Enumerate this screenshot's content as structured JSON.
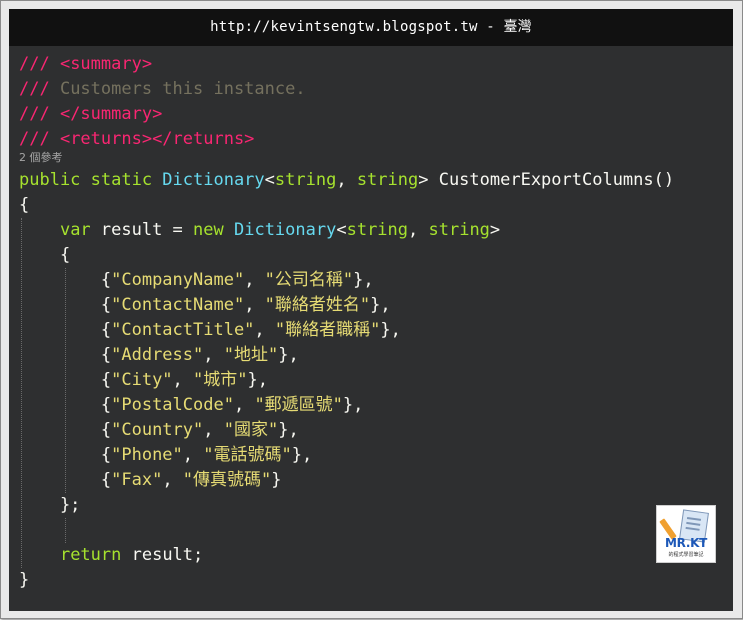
{
  "banner": {
    "text": "http://kevintsengtw.blogspot.tw - 臺灣"
  },
  "codelens": {
    "text": "2 個參考"
  },
  "colors": {
    "background": "#2e2f30",
    "default": "#f8f8f2",
    "comment_marker": "#f92672",
    "comment_text": "#75715e",
    "keyword": "#a6e22e",
    "type": "#66d9ef",
    "string": "#e6db74"
  },
  "code": {
    "lines": [
      [
        {
          "t": "/// ",
          "c": "comment_marker"
        },
        {
          "t": "<summary>",
          "c": "comment_marker"
        }
      ],
      [
        {
          "t": "/// ",
          "c": "comment_marker"
        },
        {
          "t": "Customers this instance.",
          "c": "comment_text"
        }
      ],
      [
        {
          "t": "/// ",
          "c": "comment_marker"
        },
        {
          "t": "</summary>",
          "c": "comment_marker"
        }
      ],
      [
        {
          "t": "/// ",
          "c": "comment_marker"
        },
        {
          "t": "<returns></returns>",
          "c": "comment_marker"
        }
      ],
      [
        {
          "t": "public static ",
          "c": "keyword"
        },
        {
          "t": "Dictionary",
          "c": "type"
        },
        {
          "t": "<",
          "c": "default"
        },
        {
          "t": "string",
          "c": "keyword"
        },
        {
          "t": ", ",
          "c": "default"
        },
        {
          "t": "string",
          "c": "keyword"
        },
        {
          "t": "> CustomerExportColumns()",
          "c": "default"
        }
      ],
      [
        {
          "t": "{",
          "c": "default"
        }
      ],
      [
        {
          "t": "    ",
          "c": "default"
        },
        {
          "t": "var",
          "c": "keyword"
        },
        {
          "t": " result = ",
          "c": "default"
        },
        {
          "t": "new ",
          "c": "keyword"
        },
        {
          "t": "Dictionary",
          "c": "type"
        },
        {
          "t": "<",
          "c": "default"
        },
        {
          "t": "string",
          "c": "keyword"
        },
        {
          "t": ", ",
          "c": "default"
        },
        {
          "t": "string",
          "c": "keyword"
        },
        {
          "t": ">",
          "c": "default"
        }
      ],
      [
        {
          "t": "    {",
          "c": "default"
        }
      ],
      [
        {
          "t": "        {",
          "c": "default"
        },
        {
          "t": "\"CompanyName\"",
          "c": "string"
        },
        {
          "t": ", ",
          "c": "default"
        },
        {
          "t": "\"公司名稱\"",
          "c": "string"
        },
        {
          "t": "},",
          "c": "default"
        }
      ],
      [
        {
          "t": "        {",
          "c": "default"
        },
        {
          "t": "\"ContactName\"",
          "c": "string"
        },
        {
          "t": ", ",
          "c": "default"
        },
        {
          "t": "\"聯絡者姓名\"",
          "c": "string"
        },
        {
          "t": "},",
          "c": "default"
        }
      ],
      [
        {
          "t": "        {",
          "c": "default"
        },
        {
          "t": "\"ContactTitle\"",
          "c": "string"
        },
        {
          "t": ", ",
          "c": "default"
        },
        {
          "t": "\"聯絡者職稱\"",
          "c": "string"
        },
        {
          "t": "},",
          "c": "default"
        }
      ],
      [
        {
          "t": "        {",
          "c": "default"
        },
        {
          "t": "\"Address\"",
          "c": "string"
        },
        {
          "t": ", ",
          "c": "default"
        },
        {
          "t": "\"地址\"",
          "c": "string"
        },
        {
          "t": "},",
          "c": "default"
        }
      ],
      [
        {
          "t": "        {",
          "c": "default"
        },
        {
          "t": "\"City\"",
          "c": "string"
        },
        {
          "t": ", ",
          "c": "default"
        },
        {
          "t": "\"城市\"",
          "c": "string"
        },
        {
          "t": "},",
          "c": "default"
        }
      ],
      [
        {
          "t": "        {",
          "c": "default"
        },
        {
          "t": "\"PostalCode\"",
          "c": "string"
        },
        {
          "t": ", ",
          "c": "default"
        },
        {
          "t": "\"郵遞區號\"",
          "c": "string"
        },
        {
          "t": "},",
          "c": "default"
        }
      ],
      [
        {
          "t": "        {",
          "c": "default"
        },
        {
          "t": "\"Country\"",
          "c": "string"
        },
        {
          "t": ", ",
          "c": "default"
        },
        {
          "t": "\"國家\"",
          "c": "string"
        },
        {
          "t": "},",
          "c": "default"
        }
      ],
      [
        {
          "t": "        {",
          "c": "default"
        },
        {
          "t": "\"Phone\"",
          "c": "string"
        },
        {
          "t": ", ",
          "c": "default"
        },
        {
          "t": "\"電話號碼\"",
          "c": "string"
        },
        {
          "t": "},",
          "c": "default"
        }
      ],
      [
        {
          "t": "        {",
          "c": "default"
        },
        {
          "t": "\"Fax\"",
          "c": "string"
        },
        {
          "t": ", ",
          "c": "default"
        },
        {
          "t": "\"傳真號碼\"",
          "c": "string"
        },
        {
          "t": "}",
          "c": "default"
        }
      ],
      [
        {
          "t": "    };",
          "c": "default"
        }
      ],
      [
        {
          "t": "",
          "c": "default"
        }
      ],
      [
        {
          "t": "    ",
          "c": "default"
        },
        {
          "t": "return",
          "c": "keyword"
        },
        {
          "t": " result;",
          "c": "default"
        }
      ],
      [
        {
          "t": "}",
          "c": "default"
        }
      ]
    ]
  },
  "logo": {
    "brand": "MR.KT",
    "tagline": "的程式學習筆記"
  }
}
